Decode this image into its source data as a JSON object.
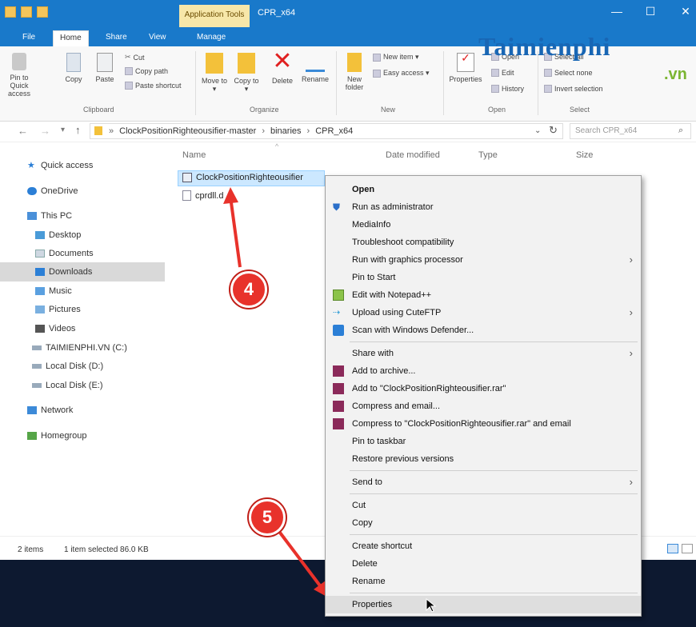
{
  "window": {
    "context_tab": "Application Tools",
    "title": "CPR_x64"
  },
  "tabs": [
    "File",
    "Home",
    "Share",
    "View",
    "Manage"
  ],
  "ribbon": {
    "clipboard": {
      "pin": "Pin to Quick access",
      "copy": "Copy",
      "paste": "Paste",
      "cut": "Cut",
      "copy_path": "Copy path",
      "paste_shortcut": "Paste shortcut",
      "label": "Clipboard"
    },
    "organize": {
      "move_to": "Move to ▾",
      "copy_to": "Copy to ▾",
      "delete": "Delete",
      "rename": "Rename",
      "label": "Organize"
    },
    "new": {
      "new_folder": "New folder",
      "new_item": "New item ▾",
      "easy_access": "Easy access ▾",
      "label": "New"
    },
    "open": {
      "properties": "Properties",
      "open": "Open",
      "edit": "Edit",
      "history": "History",
      "label": "Open"
    },
    "select": {
      "select_all": "Select all",
      "select_none": "Select none",
      "invert": "Invert selection",
      "label": "Select"
    }
  },
  "address": {
    "path": [
      "ClockPositionRighteousifier-master",
      "binaries",
      "CPR_x64"
    ],
    "search_placeholder": "Search CPR_x64"
  },
  "nav": [
    "Quick access",
    "OneDrive",
    "This PC",
    "Desktop",
    "Documents",
    "Downloads",
    "Music",
    "Pictures",
    "Videos",
    "TAIMIENPHI.VN (C:)",
    "Local Disk (D:)",
    "Local Disk (E:)",
    "Network",
    "Homegroup"
  ],
  "columns": [
    "Name",
    "Date modified",
    "Type",
    "Size"
  ],
  "files": [
    "ClockPositionRighteousifier",
    "cprdll.d"
  ],
  "status": {
    "items": "2 items",
    "selected": "1 item selected  86.0 KB"
  },
  "context_menu": [
    "Open",
    "Run as administrator",
    "MediaInfo",
    "Troubleshoot compatibility",
    "Run with graphics processor",
    "Pin to Start",
    "Edit with Notepad++",
    "Upload using CuteFTP",
    "Scan with Windows Defender...",
    "Share with",
    "Add to archive...",
    "Add to \"ClockPositionRighteousifier.rar\"",
    "Compress and email...",
    "Compress to \"ClockPositionRighteousifier.rar\" and email",
    "Pin to taskbar",
    "Restore previous versions",
    "Send to",
    "Cut",
    "Copy",
    "Create shortcut",
    "Delete",
    "Rename",
    "Properties"
  ],
  "badges": [
    "4",
    "5"
  ],
  "watermark": {
    "logo": "Taimienphi",
    "suffix": ".vn"
  },
  "colors": {
    "titlebar": "#1979ca",
    "badge": "#e8322b",
    "menu_bg": "#f2f2f2"
  }
}
